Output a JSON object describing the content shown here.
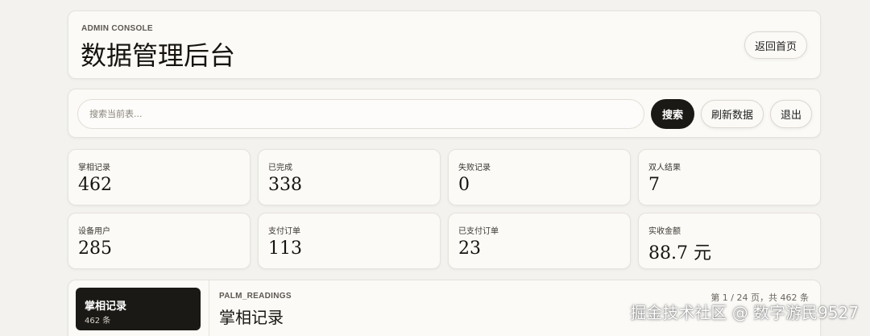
{
  "header": {
    "eyebrow": "ADMIN CONSOLE",
    "title": "数据管理后台",
    "home_label": "返回首页"
  },
  "toolbar": {
    "search_placeholder": "搜索当前表...",
    "search_label": "搜索",
    "refresh_label": "刷新数据",
    "logout_label": "退出"
  },
  "stats": [
    {
      "label": "掌相记录",
      "value": "462"
    },
    {
      "label": "已完成",
      "value": "338"
    },
    {
      "label": "失败记录",
      "value": "0"
    },
    {
      "label": "双人结果",
      "value": "7"
    },
    {
      "label": "设备用户",
      "value": "285"
    },
    {
      "label": "支付订单",
      "value": "113"
    },
    {
      "label": "已支付订单",
      "value": "23"
    },
    {
      "label": "实收金额",
      "value": "88.7 元"
    }
  ],
  "table_nav": {
    "active_title": "掌相记录",
    "active_count": "462 条"
  },
  "table": {
    "eyebrow": "PALM_READINGS",
    "title": "掌相记录",
    "pagination": "第 1 / 24 页，共 462 条"
  },
  "watermark": "掘金技术社区 @ 数字游民9527"
}
